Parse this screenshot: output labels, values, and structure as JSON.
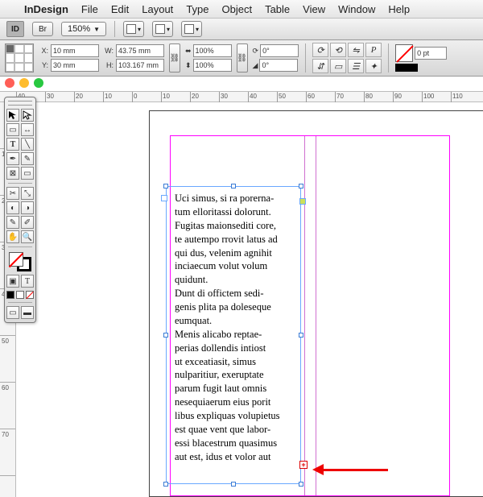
{
  "menubar": {
    "apple": "",
    "app": "InDesign",
    "items": [
      "File",
      "Edit",
      "Layout",
      "Type",
      "Object",
      "Table",
      "View",
      "Window",
      "Help"
    ]
  },
  "optbar": {
    "id_logo": "ID",
    "bridge": "Br",
    "zoom": "150%"
  },
  "control": {
    "x_label": "X:",
    "x": "10 mm",
    "y_label": "Y:",
    "y": "30 mm",
    "w_label": "W:",
    "w": "43.75 mm",
    "h_label": "H:",
    "h": "103.167 mm",
    "sx": "100%",
    "sy": "100%",
    "rot_label": "",
    "rot": "0°",
    "shear_label": "",
    "shear": "0°",
    "char_p": "P",
    "stroke_pt": "0 pt"
  },
  "ruler_h": [
    "40",
    "30",
    "20",
    "10",
    "0",
    "10",
    "20",
    "30",
    "40",
    "50",
    "60",
    "70",
    "80",
    "90",
    "100",
    "110"
  ],
  "ruler_v": [
    "",
    "10",
    "20",
    "30",
    "40",
    "50",
    "60",
    "70"
  ],
  "textframe": {
    "body": "Uci simus, si ra porerna-\ntum elloritassi dolorunt.\nFugitas maionsediti core,\nte autempo rrovit latus ad\nqui dus, velenim agnihit\ninciaecum volut volum\nquidunt.\nDunt di offictem sedi-\ngenis plita pa doleseque\neumquat.\nMenis alicabo reptae-\nperias dollendis intiost\nut exceatiasit, simus\nnulparitiur, exeruptate\nparum fugit laut omnis\nnesequiaerum eius porit\nlibus expliquas volupietus\nest quae vent que labor-\nessi blacestrum quasimus\naut est, idus et volor aut"
  },
  "overset_mark": "+"
}
